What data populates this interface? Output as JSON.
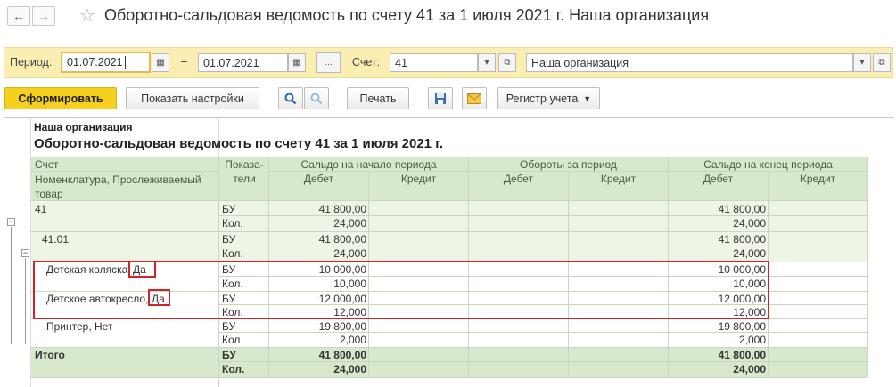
{
  "window": {
    "title": "Оборотно-сальдовая ведомость по счету 41 за 1 июля 2021 г. Наша организация",
    "back_icon": "←",
    "forward_icon": "→",
    "star_icon": "☆"
  },
  "params": {
    "period_label": "Период:",
    "date_from": "01.07.2021",
    "dash": "–",
    "date_to": "01.07.2021",
    "ellipsis": "...",
    "account_label": "Счет:",
    "account": "41",
    "organization": "Наша организация"
  },
  "toolbar": {
    "generate": "Сформировать",
    "settings": "Показать настройки",
    "print": "Печать",
    "register": "Регистр учета"
  },
  "report": {
    "org": "Наша организация",
    "title": "Оборотно-сальдовая ведомость по счету 41 за 1 июля 2021 г.",
    "headers": {
      "account": "Счет",
      "subconto": "Номенклатура, Прослеживаемый товар",
      "indicators": "Показа-тели",
      "opening": "Сальдо на начало периода",
      "turnover": "Обороты за период",
      "closing": "Сальдо на конец периода",
      "debit": "Дебет",
      "credit": "Кредит"
    },
    "rows": [
      {
        "name": "41",
        "ind": "БУ",
        "od": "41 800,00",
        "cd": "41 800,00"
      },
      {
        "name": "",
        "ind": "Кол.",
        "od": "24,000",
        "cd": "24,000"
      },
      {
        "name": "41.01",
        "ind": "БУ",
        "od": "41 800,00",
        "cd": "41 800,00"
      },
      {
        "name": "",
        "ind": "Кол.",
        "od": "24,000",
        "cd": "24,000"
      },
      {
        "name": "Детская коляска,",
        "flag": "Да",
        "ind": "БУ",
        "od": "10 000,00",
        "cd": "10 000,00"
      },
      {
        "name": "",
        "ind": "Кол.",
        "od": "10,000",
        "cd": "10,000"
      },
      {
        "name": "Детское автокресло,",
        "flag": "Да",
        "ind": "БУ",
        "od": "12 000,00",
        "cd": "12 000,00"
      },
      {
        "name": "",
        "ind": "Кол.",
        "od": "12,000",
        "cd": "12,000"
      },
      {
        "name": "Принтер, Нет",
        "ind": "БУ",
        "od": "19 800,00",
        "cd": "19 800,00"
      },
      {
        "name": "",
        "ind": "Кол.",
        "od": "2,000",
        "cd": "2,000"
      },
      {
        "name": "Итого",
        "ind": "БУ",
        "od": "41 800,00",
        "cd": "41 800,00"
      },
      {
        "name": "",
        "ind": "Кол.",
        "od": "24,000",
        "cd": "24,000"
      }
    ]
  }
}
